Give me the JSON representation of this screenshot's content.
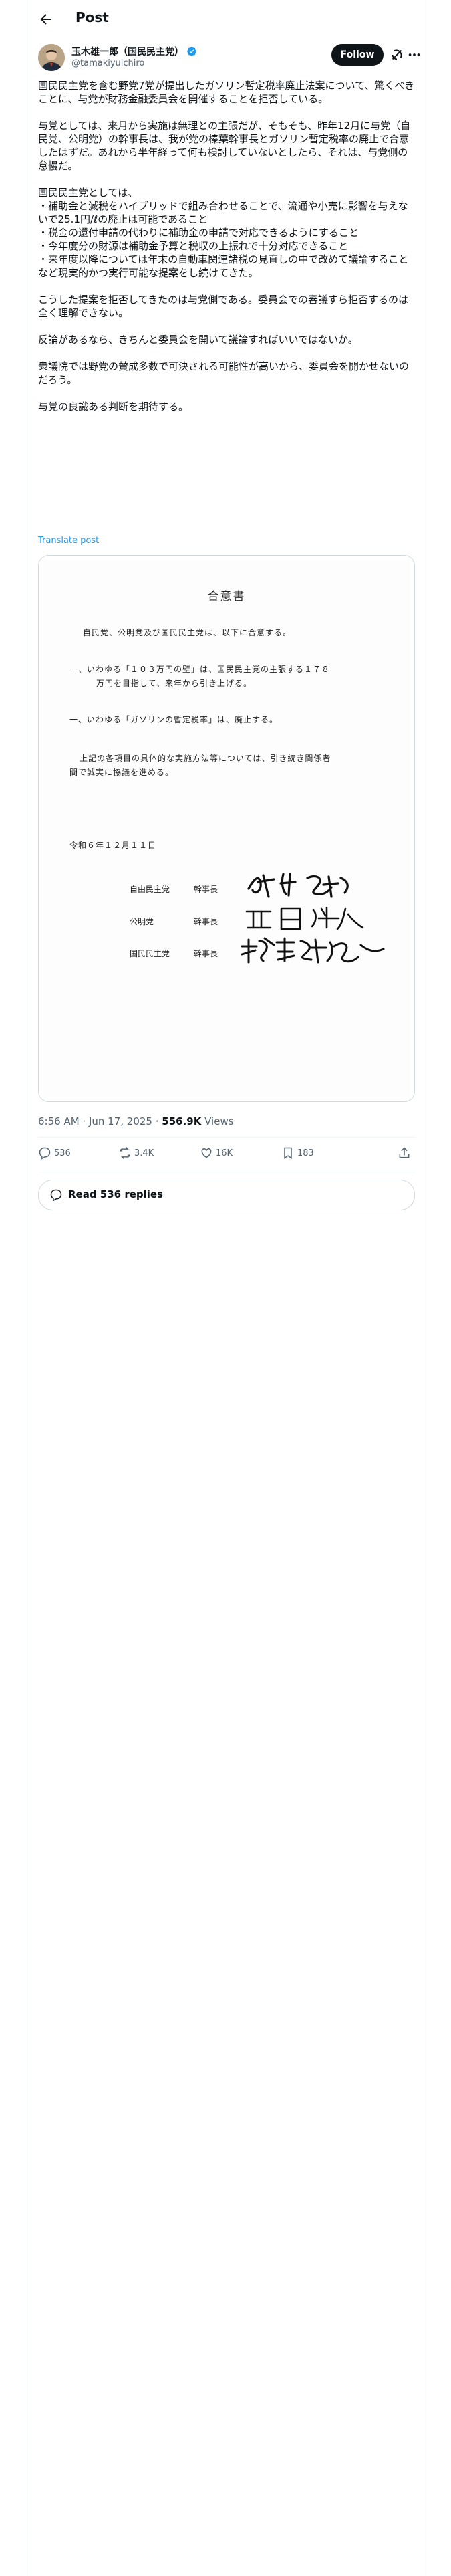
{
  "header": {
    "title": "Post",
    "back_icon": "arrow-left-icon"
  },
  "author": {
    "name": "玉木雄一郎（国民民主党）",
    "handle": "@tamakiyuichiro",
    "verified_icon": "verified-badge-icon",
    "follow_label": "Follow"
  },
  "tweet": {
    "paragraphs": [
      "国民民主党を含む野党7党が提出したガソリン暫定税率廃止法案について、驚くべきことに、与党が財務金融委員会を開催することを拒否している。",
      "与党としては、来月から実施は無理との主張だが、そもそも、昨年12月に与党（自民党、公明党）の幹事長は、我が党の榛葉幹事長とガソリン暫定税率の廃止で合意したはずだ。あれから半年経って何も検討していないとしたら、それは、与党側の怠慢だ。",
      "国民民主党としては、\n・補助金と減税をハイブリッドで組み合わせることで、流通や小売に影響を与えないで25.1円/ℓの廃止は可能であること\n・税金の還付申請の代わりに補助金の申請で対応できるようにすること\n・今年度分の財源は補助金予算と税収の上振れで十分対応できること\n・来年度以降については年末の自動車関連諸税の見直しの中で改めて議論すること\nなど現実的かつ実行可能な提案をし続けてきた。",
      "こうした提案を拒否してきたのは与党側である。委員会での審議すら拒否するのは全く理解できない。",
      "反論があるなら、きちんと委員会を開いて議論すればいいではないか。",
      "衆議院では野党の賛成多数で可決される可能性が高いから、委員会を開かせないのだろう。",
      "与党の良識ある判断を期待する。"
    ],
    "translate_label": "Translate post"
  },
  "document": {
    "title": "合意書",
    "intro": "自民党、公明党及び国民民主党は、以下に合意する。",
    "item1_line1": "一、いわゆる「１０３万円の壁」は、国民民主党の主張する１７８",
    "item1_line2": "万円を目指して、来年から引き上げる。",
    "item2": "一、いわゆる「ガソリンの暫定税率」は、廃止する。",
    "closing_line1": "上記の各項目の具体的な実施方法等については、引き続き関係者",
    "closing_line2": "間で誠実に協議を進める。",
    "date": "令和６年１２月１１日",
    "signatories": [
      {
        "party": "自由民主党",
        "role": "幹事長"
      },
      {
        "party": "公明党",
        "role": "幹事長"
      },
      {
        "party": "国民民主党",
        "role": "幹事長"
      }
    ]
  },
  "meta": {
    "time": "6:56 AM · Jun 17, 2025 · ",
    "views_count": "556.9K",
    "views_label": " Views"
  },
  "actions": {
    "replies": "536",
    "reposts": "3.4K",
    "likes": "16K",
    "bookmarks": "183"
  },
  "read_replies_label": "Read 536 replies"
}
